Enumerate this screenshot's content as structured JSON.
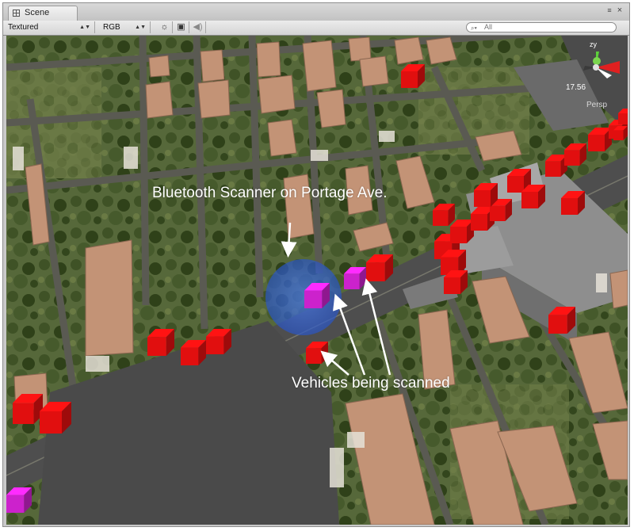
{
  "window": {
    "tab_label": "Scene"
  },
  "toolbar": {
    "render_mode": "Textured",
    "color_mode": "RGB",
    "search_placeholder": "All"
  },
  "gizmo": {
    "axis_label": "zy",
    "value": "17.56",
    "projection": "Persp"
  },
  "annotations": {
    "scanner_label": "Bluetooth Scanner on Portage Ave.",
    "vehicles_label": "Vehicles being scanned"
  },
  "colors": {
    "vehicle": "#e10f0f",
    "scanned_vehicle": "#cc22cc",
    "scanner_zone": "#3d6fd8",
    "road": "#4e4e4e",
    "parking_lot": "#4a4a4a",
    "roof": "#c39376"
  },
  "icons": {
    "tab": "scene-grid-icon",
    "lighting": "sun-icon",
    "image_effects": "picture-icon",
    "audio": "speaker-icon",
    "search": "search-icon"
  }
}
